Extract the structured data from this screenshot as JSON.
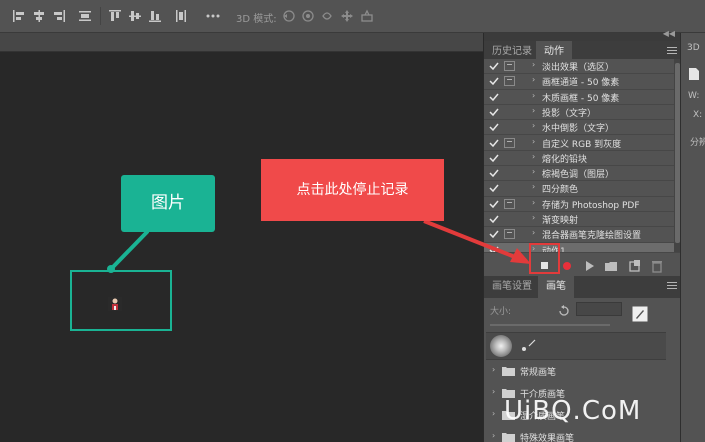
{
  "optionsbar": {
    "label_3d": "3D 模式:"
  },
  "panel_tabs": {
    "history": "历史记录",
    "actions": "动作"
  },
  "actions": [
    {
      "label": "淡出效果（选区）",
      "checked": true,
      "dialog": true
    },
    {
      "label": "画框通道 - 50 像素",
      "checked": true,
      "dialog": true
    },
    {
      "label": "木质画框 - 50 像素",
      "checked": true,
      "dialog": false
    },
    {
      "label": "投影（文字）",
      "checked": true,
      "dialog": false
    },
    {
      "label": "水中倒影（文字）",
      "checked": true,
      "dialog": false
    },
    {
      "label": "自定义 RGB 到灰度",
      "checked": true,
      "dialog": true
    },
    {
      "label": "熔化的铅块",
      "checked": true,
      "dialog": false
    },
    {
      "label": "棕褐色调（图层）",
      "checked": true,
      "dialog": false
    },
    {
      "label": "四分颜色",
      "checked": true,
      "dialog": false
    },
    {
      "label": "存储为 Photoshop PDF",
      "checked": true,
      "dialog": true
    },
    {
      "label": "渐变映射",
      "checked": true,
      "dialog": false
    },
    {
      "label": "混合器画笔克隆绘图设置",
      "checked": true,
      "dialog": true
    },
    {
      "label": "动作1",
      "checked": true,
      "dialog": false
    }
  ],
  "brush_tabs": {
    "brush_settings": "画笔设置",
    "brushes": "画笔"
  },
  "brush_panel": {
    "size_label": "大小:",
    "folders": [
      "常规画笔",
      "干介质画笔",
      "湿介质画笔",
      "特殊效果画笔"
    ]
  },
  "far_right": {
    "tab_label": "3D",
    "w_label": "W:",
    "x_label": "X:",
    "fen_label": "分辨"
  },
  "annotations": {
    "image_label": "图片",
    "instruction": "点击此处停止记录"
  },
  "watermark": "UiBQ.CoM",
  "colors": {
    "teal": "#1ab394",
    "red": "#f04a4a",
    "record": "#e8303a"
  }
}
